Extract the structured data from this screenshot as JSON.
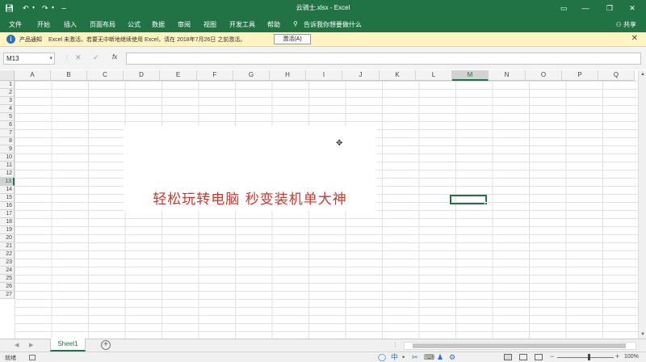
{
  "window": {
    "title": "云骑士.xlsx  -  Excel",
    "share_label": "共享"
  },
  "ribbon": {
    "tabs": [
      "文件",
      "开始",
      "插入",
      "页面布局",
      "公式",
      "数据",
      "审阅",
      "视图",
      "开发工具",
      "帮助"
    ],
    "tell_me": "告诉我你想要做什么"
  },
  "message_bar": {
    "title": "产品通知",
    "text": "Excel 未激活。若要无中断地继续使用 Excel，请在 2018年7月26日 之前激活。",
    "button": "激活(A)"
  },
  "formula_bar": {
    "name_box": "M13",
    "fx": "fx",
    "formula": ""
  },
  "grid": {
    "columns": [
      "A",
      "B",
      "C",
      "D",
      "E",
      "F",
      "G",
      "H",
      "I",
      "J",
      "K",
      "L",
      "M",
      "N",
      "O",
      "P",
      "Q"
    ],
    "selected_column": "M",
    "rows": [
      "1",
      "2",
      "3",
      "4",
      "5",
      "6",
      "7",
      "8",
      "9",
      "10",
      "11",
      "12",
      "13",
      "14",
      "15",
      "16",
      "17",
      "18",
      "19",
      "20",
      "21",
      "22",
      "23",
      "24",
      "25",
      "26",
      "27"
    ],
    "selected_row": "13",
    "selected_cell": "M13"
  },
  "banner": {
    "text": "轻松玩转电脑  秒变装机单大神",
    "color": "#c8372d"
  },
  "sheets": {
    "tabs": [
      "Sheet1"
    ],
    "active": "Sheet1",
    "dots": "⋮"
  },
  "status": {
    "ready": "就绪",
    "ime_label": "中",
    "zoom": "100%"
  },
  "colors": {
    "accent": "#217346",
    "message_bg": "#fff4c2"
  }
}
